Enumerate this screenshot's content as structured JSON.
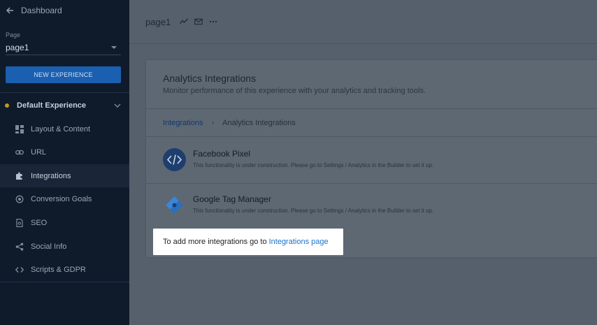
{
  "sidebar": {
    "back_label": "Dashboard",
    "page_label": "Page",
    "page_value": "page1",
    "new_experience_label": "NEW EXPERIENCE",
    "experience_label": "Default Experience",
    "items": [
      {
        "label": "Layout & Content",
        "icon": "layout-icon"
      },
      {
        "label": "URL",
        "icon": "link-icon"
      },
      {
        "label": "Integrations",
        "icon": "puzzle-icon"
      },
      {
        "label": "Conversion Goals",
        "icon": "target-icon"
      },
      {
        "label": "SEO",
        "icon": "document-icon"
      },
      {
        "label": "Social Info",
        "icon": "share-icon"
      },
      {
        "label": "Scripts & GDPR",
        "icon": "code-icon"
      }
    ],
    "active_item": "Integrations"
  },
  "topbar": {
    "title": "page1"
  },
  "panel": {
    "title": "Analytics Integrations",
    "subtitle": "Monitor performance of this experience with your analytics and tracking tools.",
    "breadcrumb": {
      "link": "Integrations",
      "current": "Analytics Integrations"
    },
    "integrations": [
      {
        "name": "Facebook Pixel",
        "description": "This functionality is under construction. Please go to Settings / Analytics in the Builder to set it up."
      },
      {
        "name": "Google Tag Manager",
        "description": "This functionality is under construction. Please go to Settings / Analytics in the Builder to set it up."
      }
    ]
  },
  "highlight": {
    "text": "To add more integrations go to",
    "link": "Integrations page"
  },
  "colors": {
    "sidebar_bg": "#0f1b2b",
    "accent_blue": "#1a5fb0",
    "link_blue": "#1a73c9",
    "dot_yellow": "#c29a1a"
  }
}
